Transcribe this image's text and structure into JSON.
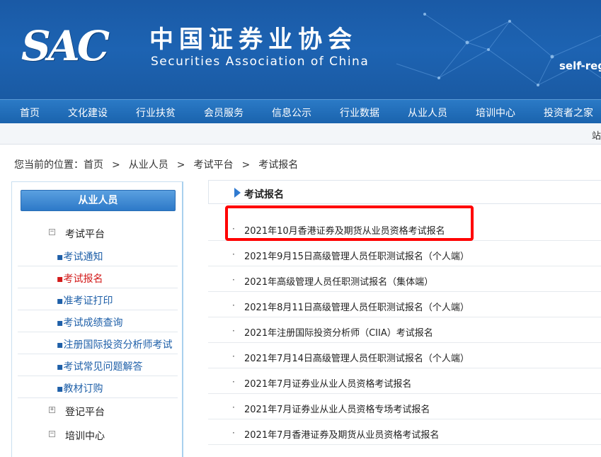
{
  "header": {
    "logo_text": "SAC",
    "org_name_cn": "中国证券业协会",
    "org_name_en": "Securities Association of China",
    "self_reg": "self-reg"
  },
  "nav": {
    "items": [
      "首页",
      "文化建设",
      "行业扶贫",
      "会员服务",
      "信息公示",
      "行业数据",
      "从业人员",
      "培训中心",
      "投资者之家"
    ]
  },
  "substrip": {
    "text": "站"
  },
  "breadcrumb": {
    "prefix": "您当前的位置：",
    "items": [
      "首页",
      "从业人员",
      "考试平台",
      "考试报名"
    ],
    "separator": ">"
  },
  "sidebar": {
    "title": "从业人员",
    "groups": [
      {
        "toggle": "−",
        "label": "考试平台"
      },
      {
        "toggle": "+",
        "label": "登记平台"
      },
      {
        "toggle": "−",
        "label": "培训中心"
      }
    ],
    "sub_items": [
      {
        "label": "▪考试通知",
        "active": false
      },
      {
        "label": "▪考试报名",
        "active": true
      },
      {
        "label": "▪准考证打印",
        "active": false
      },
      {
        "label": "▪考试成绩查询",
        "active": false
      },
      {
        "label": "▪注册国际投资分析师考试",
        "active": false
      },
      {
        "label": "▪考试常见问题解答",
        "active": false
      },
      {
        "label": "▪教材订购",
        "active": false
      }
    ]
  },
  "content": {
    "title": "考试报名",
    "bullet": "·",
    "items": [
      "2021年10月香港证券及期货从业员资格考试报名",
      "2021年9月15日高级管理人员任职测试报名（个人端）",
      "2021年高级管理人员任职测试报名（集体端）",
      "2021年8月11日高级管理人员任职测试报名（个人端）",
      "2021年注册国际投资分析师（CIIA）考试报名",
      "2021年7月14日高级管理人员任职测试报名（个人端）",
      "2021年7月证券业从业人员资格考试报名",
      "2021年7月证券业从业人员资格专场考试报名",
      "2021年7月香港证券及期货从业员资格考试报名"
    ]
  },
  "colors": {
    "banner": "#1d63b2",
    "nav": "#1a63ad",
    "link": "#1e5fa8",
    "active": "#d21a1a",
    "highlight": "#ff0000"
  }
}
